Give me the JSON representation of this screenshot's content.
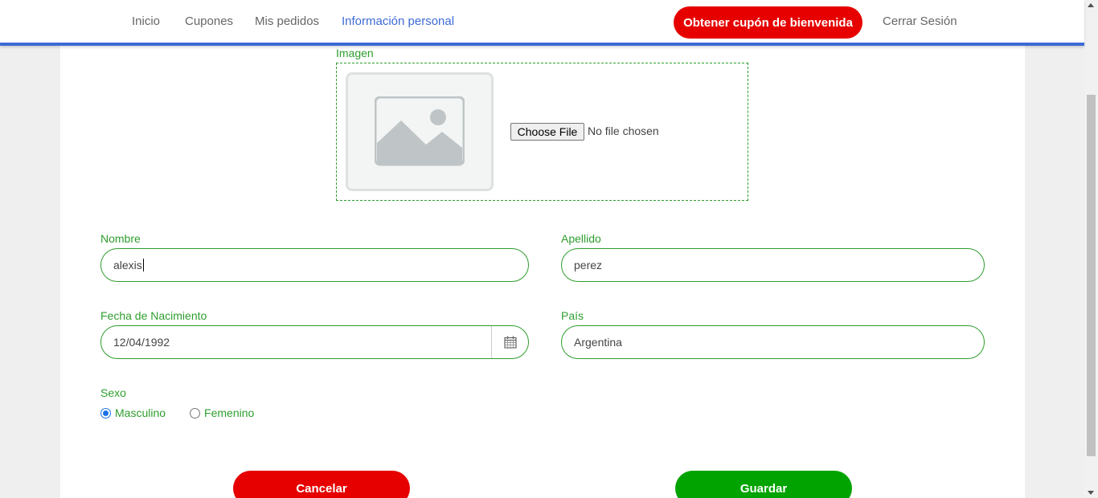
{
  "nav": {
    "links": [
      "Inicio",
      "Cupones",
      "Mis pedidos",
      "Información personal"
    ],
    "promo_label": "Obtener cupón de bienvenida",
    "logout_label": "Cerrar Sesión"
  },
  "image_section": {
    "label": "Imagen",
    "file_button": "Choose File",
    "file_status": "No file chosen"
  },
  "form": {
    "nombre": {
      "label": "Nombre",
      "value": "alexis"
    },
    "apellido": {
      "label": "Apellido",
      "value": "perez"
    },
    "fecha": {
      "label": "Fecha de Nacimiento",
      "value": "12/04/1992"
    },
    "pais": {
      "label": "País",
      "value": "Argentina"
    },
    "sexo": {
      "label": "Sexo",
      "options": [
        "Masculino",
        "Femenino"
      ],
      "selected": "Masculino"
    }
  },
  "actions": {
    "cancel_label": "Cancelar",
    "save_label": "Guardar"
  },
  "colors": {
    "accent": "#3d6ad6",
    "label_green": "#2e9e2e",
    "danger_red": "#e60000",
    "success_green": "#00a300"
  }
}
